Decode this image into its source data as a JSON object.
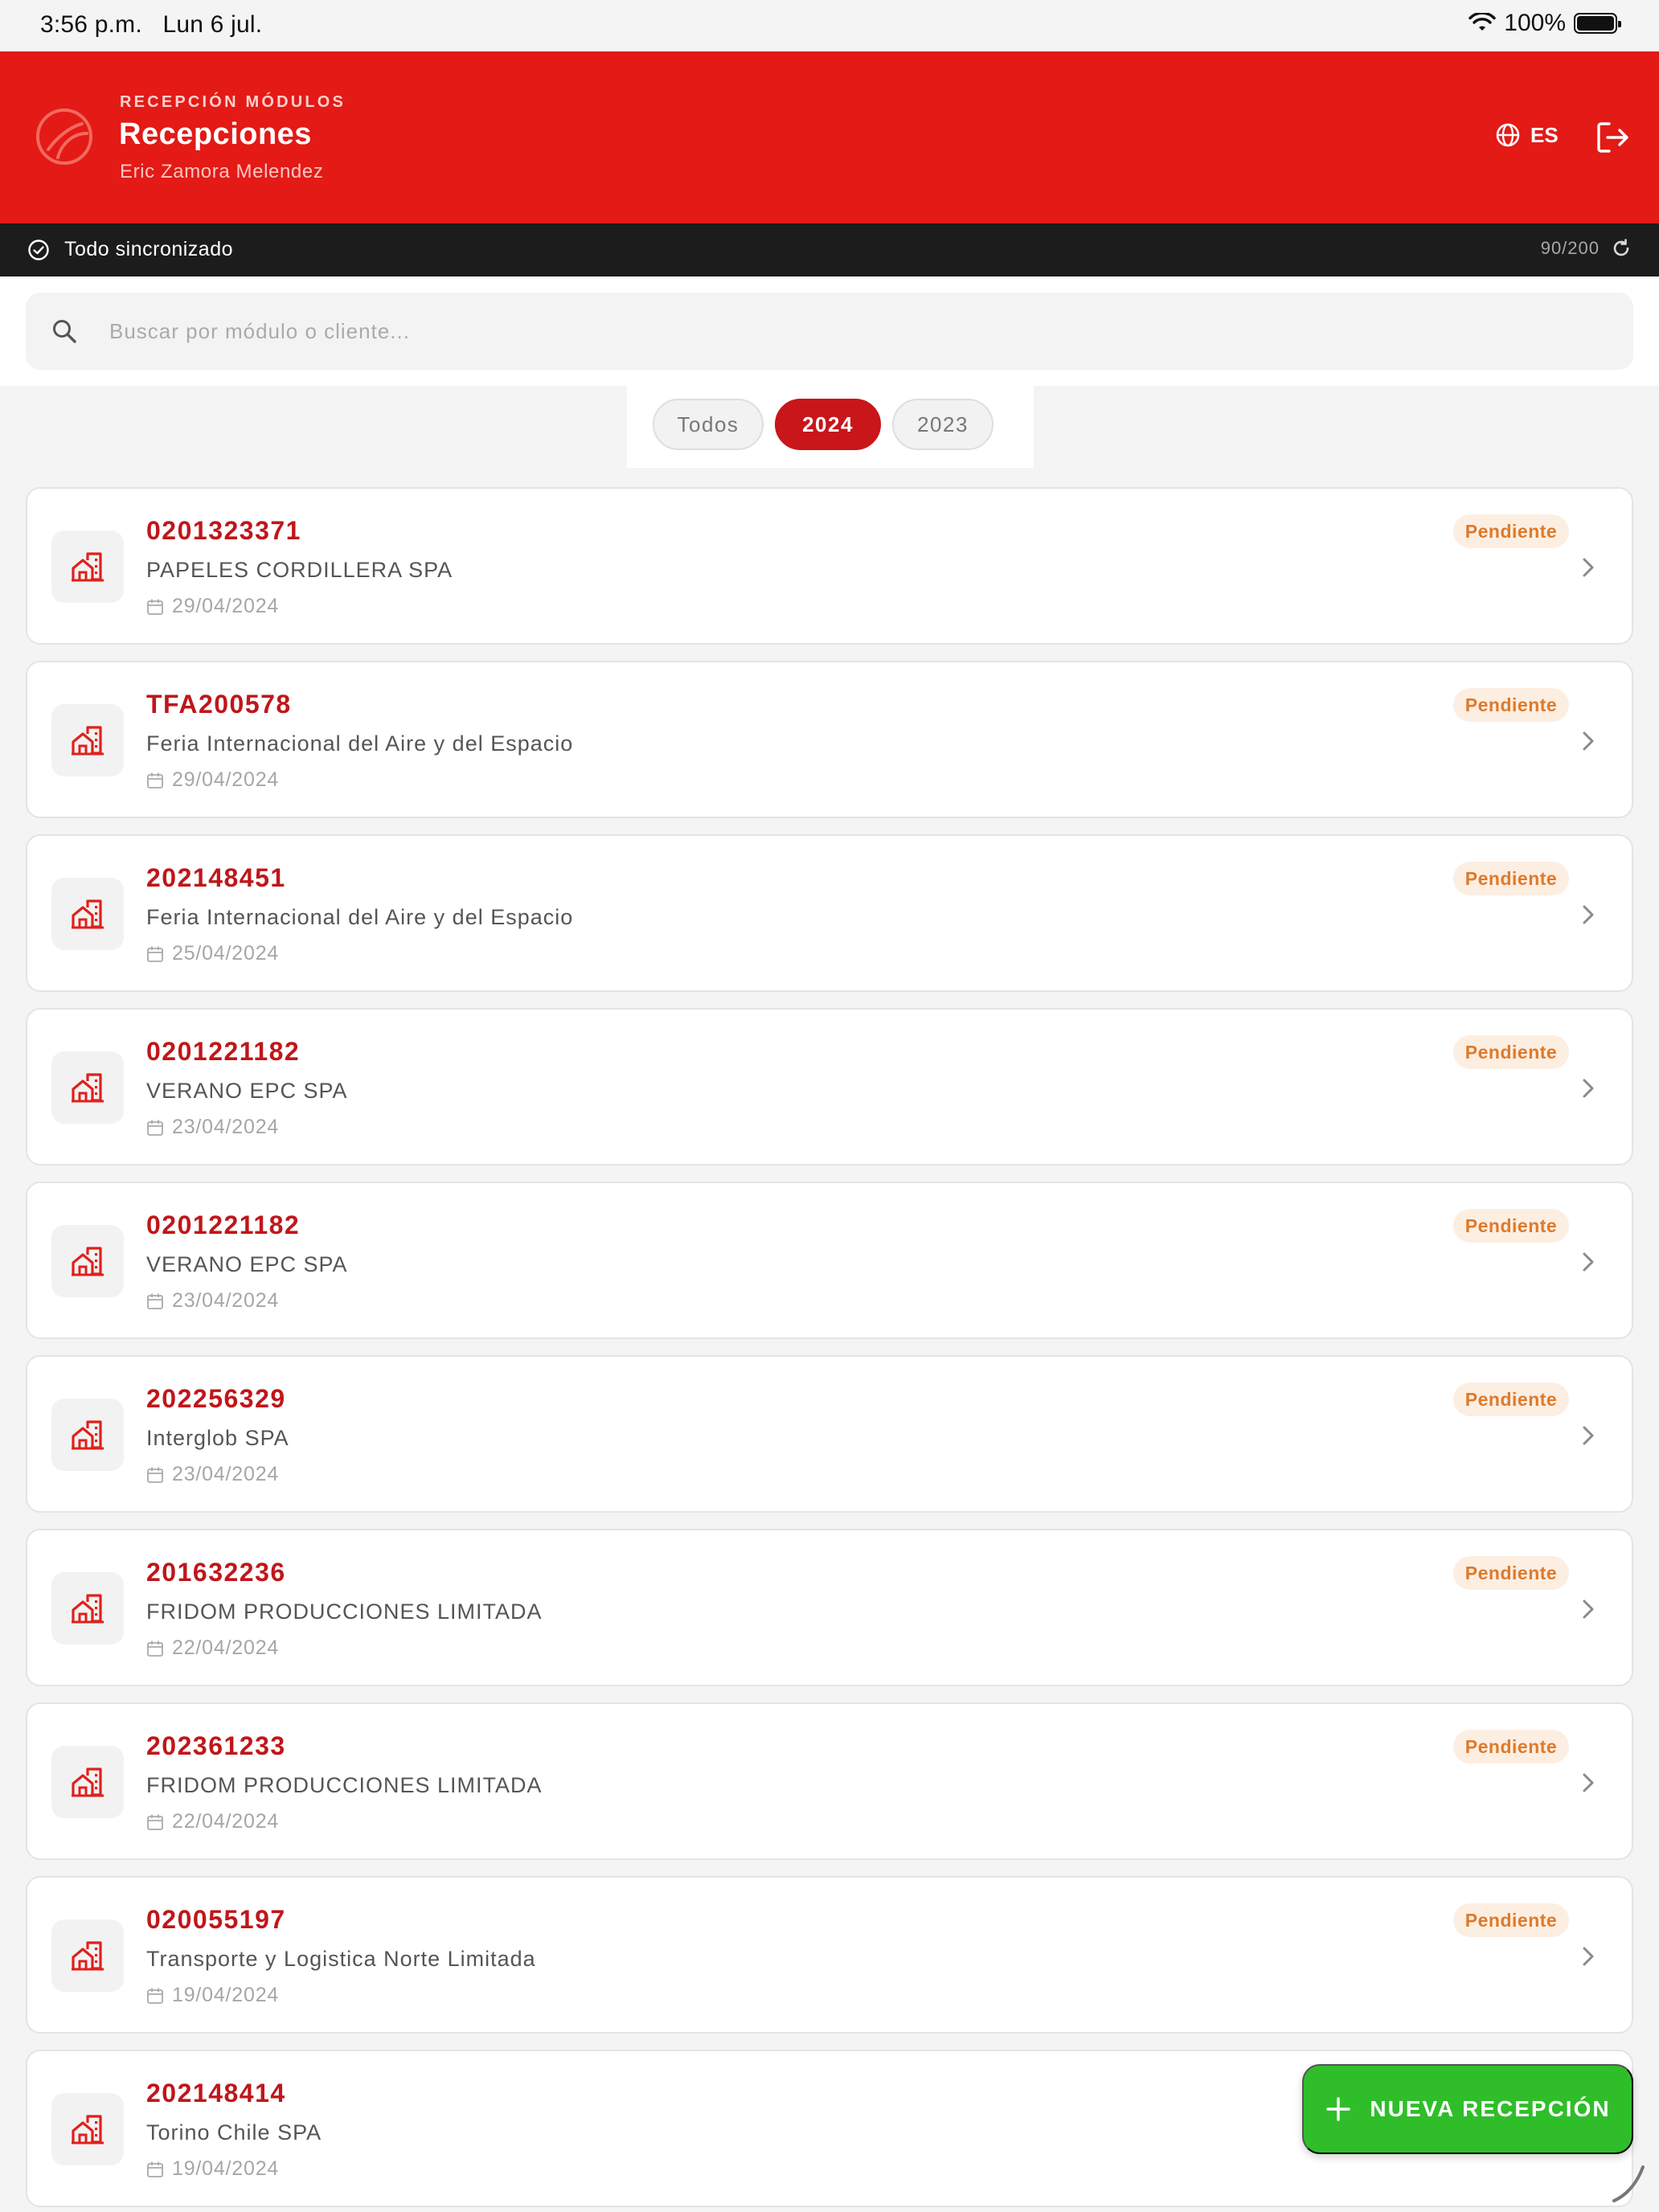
{
  "status_bar": {
    "time": "3:56 p.m.",
    "date": "Lun 6 jul.",
    "battery": "100%"
  },
  "header": {
    "eyebrow": "RECEPCIÓN MÓDULOS",
    "title": "Recepciones",
    "user": "Eric Zamora Melendez",
    "language": "ES"
  },
  "sync": {
    "label": "Todo sincronizado",
    "count": "90/200"
  },
  "search": {
    "placeholder": "Buscar por módulo o cliente..."
  },
  "filters": [
    {
      "label": "Todos",
      "active": false
    },
    {
      "label": "2024",
      "active": true
    },
    {
      "label": "2023",
      "active": false
    }
  ],
  "badge_label": "Pendiente",
  "items": [
    {
      "code": "0201323371",
      "client": "PAPELES CORDILLERA SPA",
      "date": "29/04/2024"
    },
    {
      "code": "TFA200578",
      "client": "Feria Internacional del Aire y del Espacio",
      "date": "29/04/2024"
    },
    {
      "code": "202148451",
      "client": "Feria Internacional del Aire y del Espacio",
      "date": "25/04/2024"
    },
    {
      "code": "0201221182",
      "client": "VERANO EPC SPA",
      "date": "23/04/2024"
    },
    {
      "code": "0201221182",
      "client": "VERANO EPC SPA",
      "date": "23/04/2024"
    },
    {
      "code": "202256329",
      "client": "Interglob SPA",
      "date": "23/04/2024"
    },
    {
      "code": "201632236",
      "client": "FRIDOM PRODUCCIONES LIMITADA",
      "date": "22/04/2024"
    },
    {
      "code": "202361233",
      "client": "FRIDOM PRODUCCIONES LIMITADA",
      "date": "22/04/2024"
    },
    {
      "code": "020055197",
      "client": "Transporte y Logistica Norte Limitada",
      "date": "19/04/2024"
    },
    {
      "code": "202148414",
      "client": "Torino Chile SPA",
      "date": "19/04/2024"
    }
  ],
  "fab": {
    "label": "NUEVA RECEPCIÓN"
  },
  "colors": {
    "brand_red": "#e31a16",
    "code_red": "#c0161a",
    "fab_green": "#2fbe2a",
    "badge_bg": "#fdeee2",
    "badge_text": "#de7a2a"
  }
}
